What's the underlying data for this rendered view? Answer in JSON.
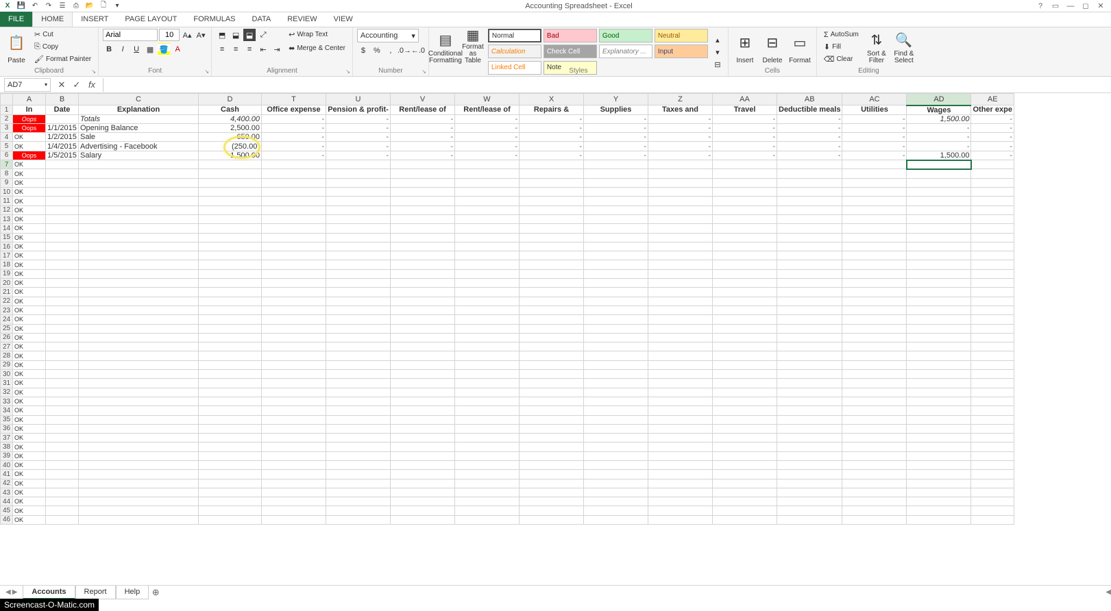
{
  "app": {
    "title": "Accounting Spreadsheet - Excel"
  },
  "qat": [
    "excel",
    "save",
    "undo",
    "redo",
    "touch",
    "print",
    "open",
    "new",
    "sort"
  ],
  "tabs": {
    "file": "FILE",
    "items": [
      "HOME",
      "INSERT",
      "PAGE LAYOUT",
      "FORMULAS",
      "DATA",
      "REVIEW",
      "VIEW"
    ],
    "active": "HOME"
  },
  "ribbon": {
    "clipboard": {
      "label": "Clipboard",
      "paste": "Paste",
      "cut": "Cut",
      "copy": "Copy",
      "format_painter": "Format Painter"
    },
    "font": {
      "label": "Font",
      "name": "Arial",
      "size": "10"
    },
    "alignment": {
      "label": "Alignment",
      "wrap": "Wrap Text",
      "merge": "Merge & Center"
    },
    "number": {
      "label": "Number",
      "format": "Accounting"
    },
    "styles": {
      "label": "Styles",
      "cond": "Conditional Formatting",
      "fat": "Format as Table",
      "cstyles": "Cell Styles",
      "cells": {
        "normal": "Normal",
        "bad": "Bad",
        "good": "Good",
        "neutral": "Neutral",
        "calculation": "Calculation",
        "check": "Check Cell",
        "explanatory": "Explanatory ...",
        "input": "Input",
        "linked": "Linked Cell",
        "note": "Note"
      }
    },
    "cells": {
      "label": "Cells",
      "insert": "Insert",
      "delete": "Delete",
      "format": "Format"
    },
    "editing": {
      "label": "Editing",
      "sum": "AutoSum",
      "fill": "Fill",
      "clear": "Clear",
      "sort": "Sort & Filter",
      "find": "Find & Select"
    }
  },
  "namebox": "AD7",
  "formula": "",
  "columns": [
    "A",
    "B",
    "C",
    "D",
    "T",
    "U",
    "V",
    "W",
    "X",
    "Y",
    "Z",
    "AA",
    "AB",
    "AC",
    "AD",
    "AE"
  ],
  "active_col": "AD",
  "active_row": 7,
  "headers": {
    "A": "In",
    "B": "Date",
    "C": "Explanation",
    "D": "Cash",
    "T": "Office expense",
    "U": "Pension & profit-",
    "V": "Rent/lease of",
    "W": "Rent/lease of",
    "X": "Repairs &",
    "Y": "Supplies",
    "Z": "Taxes and",
    "AA": "Travel",
    "AB": "Deductible meals",
    "AC": "Utilities",
    "AD": "Wages",
    "AE": "Other expe"
  },
  "totals": {
    "label": "Totals",
    "D": "4,400.00",
    "AD": "1,500.00"
  },
  "rows": [
    {
      "n": 3,
      "A": "Oops",
      "A_red": true,
      "B": "1/1/2015",
      "C": "Opening Balance",
      "D": "2,500.00"
    },
    {
      "n": 4,
      "A": "OK",
      "B": "1/2/2015",
      "C": "Sale",
      "D": "650.00"
    },
    {
      "n": 5,
      "A": "OK",
      "B": "1/4/2015",
      "C": "Advertising - Facebook",
      "D": "(250.00)"
    },
    {
      "n": 6,
      "A": "Oops",
      "A_red": true,
      "B": "1/5/2015",
      "C": "Salary",
      "D": "1,500.00",
      "AD": "1,500.00"
    }
  ],
  "empty_rows_start": 7,
  "empty_rows_end": 46,
  "sheet_tabs": [
    "Accounts",
    "Report",
    "Help"
  ],
  "active_sheet": "Accounts",
  "watermark": "Screencast-O-Matic.com"
}
